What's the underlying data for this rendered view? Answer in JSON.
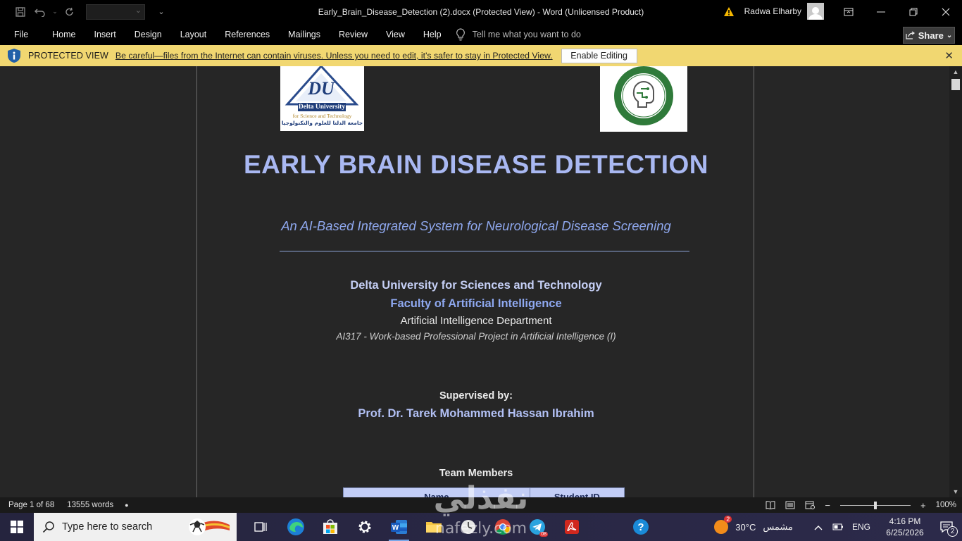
{
  "window": {
    "title": "Early_Brain_Disease_Detection (2).docx (Protected View)  -  Word (Unlicensed Product)",
    "user_name": "Radwa Elharby"
  },
  "ribbon": {
    "tabs": [
      "File",
      "Home",
      "Insert",
      "Design",
      "Layout",
      "References",
      "Mailings",
      "Review",
      "View",
      "Help"
    ],
    "tell_me_placeholder": "Tell me what you want to do",
    "share_label": "Share"
  },
  "protected_view": {
    "title": "PROTECTED VIEW",
    "message": "Be careful—files from the Internet can contain viruses. Unless you need to edit, it's safer to stay in Protected View.",
    "enable_button": "Enable Editing"
  },
  "document": {
    "logo_left_line1": "Delta University",
    "logo_left_line2": "for Science and Technology",
    "logo_left_arabic": "جامعة الدلتا للعلوم والتكنولوجيا",
    "title": "EARLY BRAIN DISEASE DETECTION",
    "subtitle": "An AI-Based Integrated System for Neurological Disease Screening",
    "university": "Delta University for Sciences and Technology",
    "faculty": "Faculty of Artificial Intelligence",
    "department": "Artificial Intelligence Department",
    "course": "AI317 - Work-based Professional Project in Artificial Intelligence (I)",
    "supervised_by_label": "Supervised by:",
    "supervisor": "Prof. Dr. Tarek Mohammed Hassan Ibrahim",
    "team_label": "Team Members",
    "table_headers": [
      "Name",
      "Student ID"
    ]
  },
  "status": {
    "page": "Page 1 of 68",
    "words": "13555 words",
    "zoom": "100%"
  },
  "taskbar": {
    "search_placeholder": "Type here to search",
    "weather_temp": "30°C",
    "weather_desc": "مشمس",
    "language": "ENG",
    "time": "4:16 PM",
    "date": "6/25/2026",
    "notifications": "2",
    "edge_badge": "2",
    "telegram_badge": "08"
  },
  "watermark": {
    "arabic": "نفذلي",
    "latin": "nafezly.com"
  }
}
